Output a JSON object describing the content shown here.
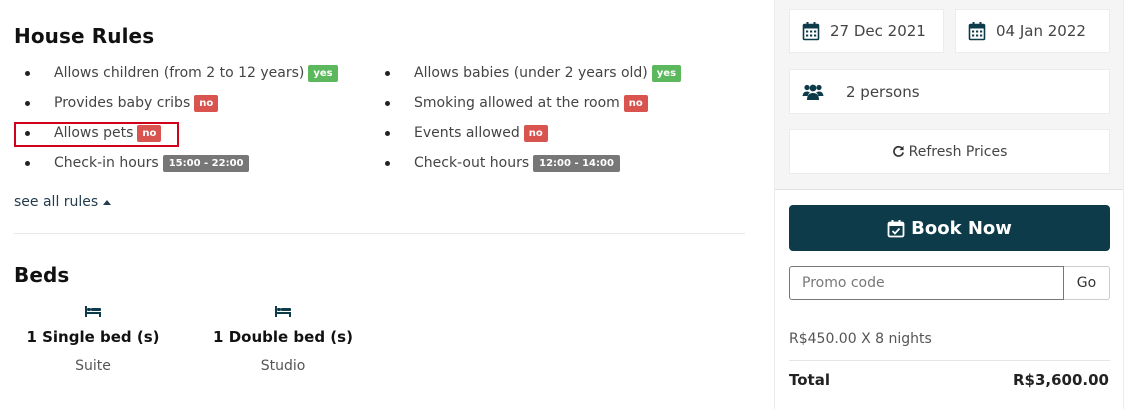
{
  "house_rules": {
    "title": "House Rules",
    "left": [
      {
        "label": "Allows children (from 2 to 12 years)",
        "badge": "yes",
        "status": "yes"
      },
      {
        "label": "Provides baby cribs",
        "badge": "no",
        "status": "no"
      },
      {
        "label": "Allows pets",
        "badge": "no",
        "status": "no"
      },
      {
        "label": "Check-in hours",
        "badge": "15:00 - 22:00",
        "status": "hours"
      }
    ],
    "right": [
      {
        "label": "Allows babies (under 2 years old)",
        "badge": "yes",
        "status": "yes"
      },
      {
        "label": "Smoking allowed at the room",
        "badge": "no",
        "status": "no"
      },
      {
        "label": "Events allowed",
        "badge": "no",
        "status": "no"
      },
      {
        "label": "Check-out hours",
        "badge": "12:00 - 14:00",
        "status": "hours"
      }
    ],
    "see_all": "see all rules"
  },
  "beds": {
    "title": "Beds",
    "items": [
      {
        "title": "1 Single bed (s)",
        "room": "Suite",
        "icon": "bed-icon"
      },
      {
        "title": "1 Double bed (s)",
        "room": "Studio",
        "icon": "bed-icon"
      }
    ]
  },
  "booking": {
    "checkin_date": "27 Dec 2021",
    "checkout_date": "04 Jan 2022",
    "persons": "2 persons",
    "refresh_label": "Refresh Prices",
    "book_label": "Book Now",
    "promo_placeholder": "Promo code",
    "promo_value": "",
    "go_label": "Go",
    "nights_line": "R$450.00 X 8 nights",
    "total_label": "Total",
    "total_value": "R$3,600.00"
  },
  "colors": {
    "primary": "#0d3b4a",
    "yes_badge": "#5cb85c",
    "no_badge": "#d9534f",
    "hours_badge": "#777777",
    "highlight_border": "#d0021b"
  }
}
